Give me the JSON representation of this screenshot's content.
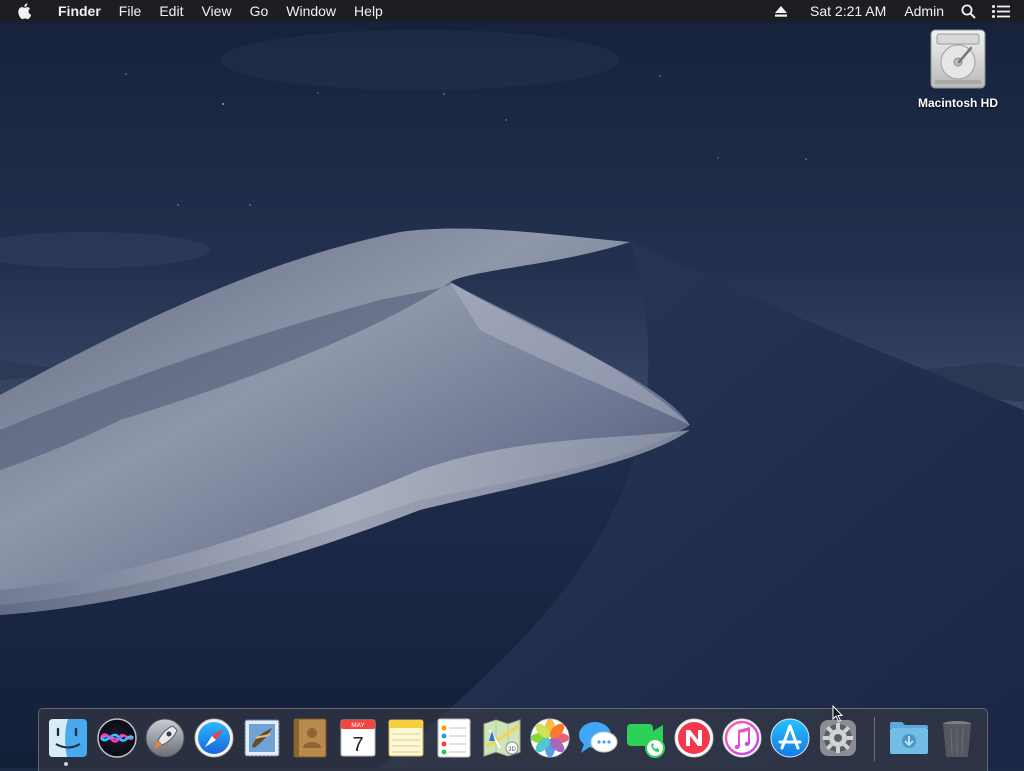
{
  "menubar": {
    "apple_icon": "apple-logo-icon",
    "app_name": "Finder",
    "menus": [
      "File",
      "Edit",
      "View",
      "Go",
      "Window",
      "Help"
    ],
    "eject_icon": "eject-icon",
    "clock": "Sat 2:21 AM",
    "user": "Admin",
    "spotlight_icon": "search-icon",
    "notification_icon": "list-icon"
  },
  "desktop": {
    "drive_label": "Macintosh HD",
    "drive_icon": "hard-drive-icon"
  },
  "dock": {
    "apps": [
      {
        "name": "Finder",
        "icon": "finder-icon",
        "running": true
      },
      {
        "name": "Siri",
        "icon": "siri-icon"
      },
      {
        "name": "Launchpad",
        "icon": "launchpad-icon"
      },
      {
        "name": "Safari",
        "icon": "safari-icon"
      },
      {
        "name": "Mail",
        "icon": "mail-icon"
      },
      {
        "name": "Contacts",
        "icon": "contacts-icon"
      },
      {
        "name": "Calendar",
        "icon": "calendar-icon",
        "month": "MAY",
        "day": "7"
      },
      {
        "name": "Notes",
        "icon": "notes-icon"
      },
      {
        "name": "Reminders",
        "icon": "reminders-icon"
      },
      {
        "name": "Maps",
        "icon": "maps-icon"
      },
      {
        "name": "Photos",
        "icon": "photos-icon"
      },
      {
        "name": "Messages",
        "icon": "messages-icon"
      },
      {
        "name": "FaceTime",
        "icon": "facetime-icon"
      },
      {
        "name": "News",
        "icon": "news-icon"
      },
      {
        "name": "iTunes",
        "icon": "itunes-icon"
      },
      {
        "name": "App Store",
        "icon": "app-store-icon"
      },
      {
        "name": "System Preferences",
        "icon": "system-preferences-icon"
      },
      {
        "name": "Downloads",
        "icon": "downloads-folder-icon"
      },
      {
        "name": "Trash",
        "icon": "trash-icon"
      }
    ]
  },
  "colors": {
    "sky_top": "#17233a",
    "sky_horizon": "#3a4c6a",
    "dune_light": "#8a93a8",
    "dune_shadow": "#1e2c4c",
    "menubar_bg": "#1e1e20"
  }
}
